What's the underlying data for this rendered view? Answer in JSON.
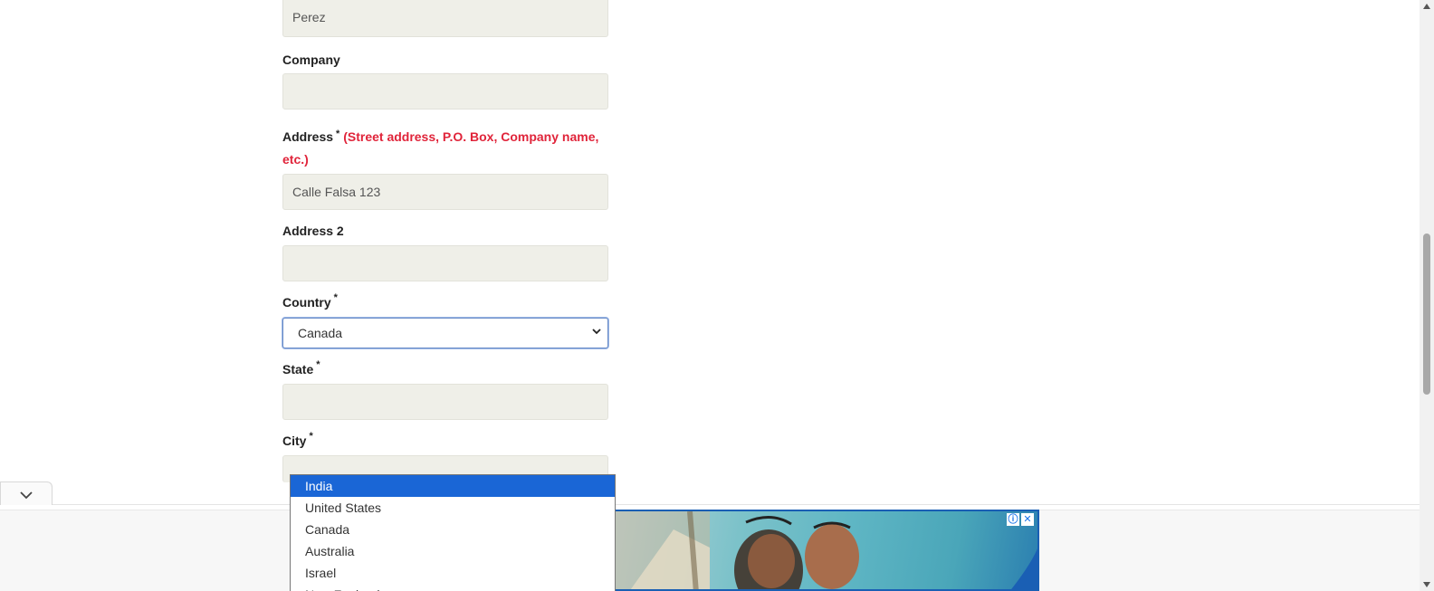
{
  "form": {
    "last_name_value": "Perez",
    "company_label": "Company",
    "company_value": "",
    "address_label": "Address",
    "address_required": "*",
    "address_hint": "(Street address, P.O. Box, Company name, etc.)",
    "address_value": "Calle Falsa 123",
    "address2_label": "Address 2",
    "address2_value": "",
    "country_label": "Country",
    "country_required": "*",
    "country_selected": "Canada",
    "state_label": "State",
    "state_required": "*",
    "state_value": "",
    "city_label": "City",
    "city_required": "*"
  },
  "country_dropdown": {
    "options": [
      "India",
      "United States",
      "Canada",
      "Australia",
      "Israel",
      "New Zealand"
    ],
    "highlighted": "India"
  },
  "ad": {
    "info_icon": "info-icon",
    "close_icon": "close-icon",
    "accent": "#1a5fb4"
  },
  "colors": {
    "required_hint": "#e0243a",
    "input_bg": "#efefe8",
    "highlight": "#1a66d6"
  }
}
